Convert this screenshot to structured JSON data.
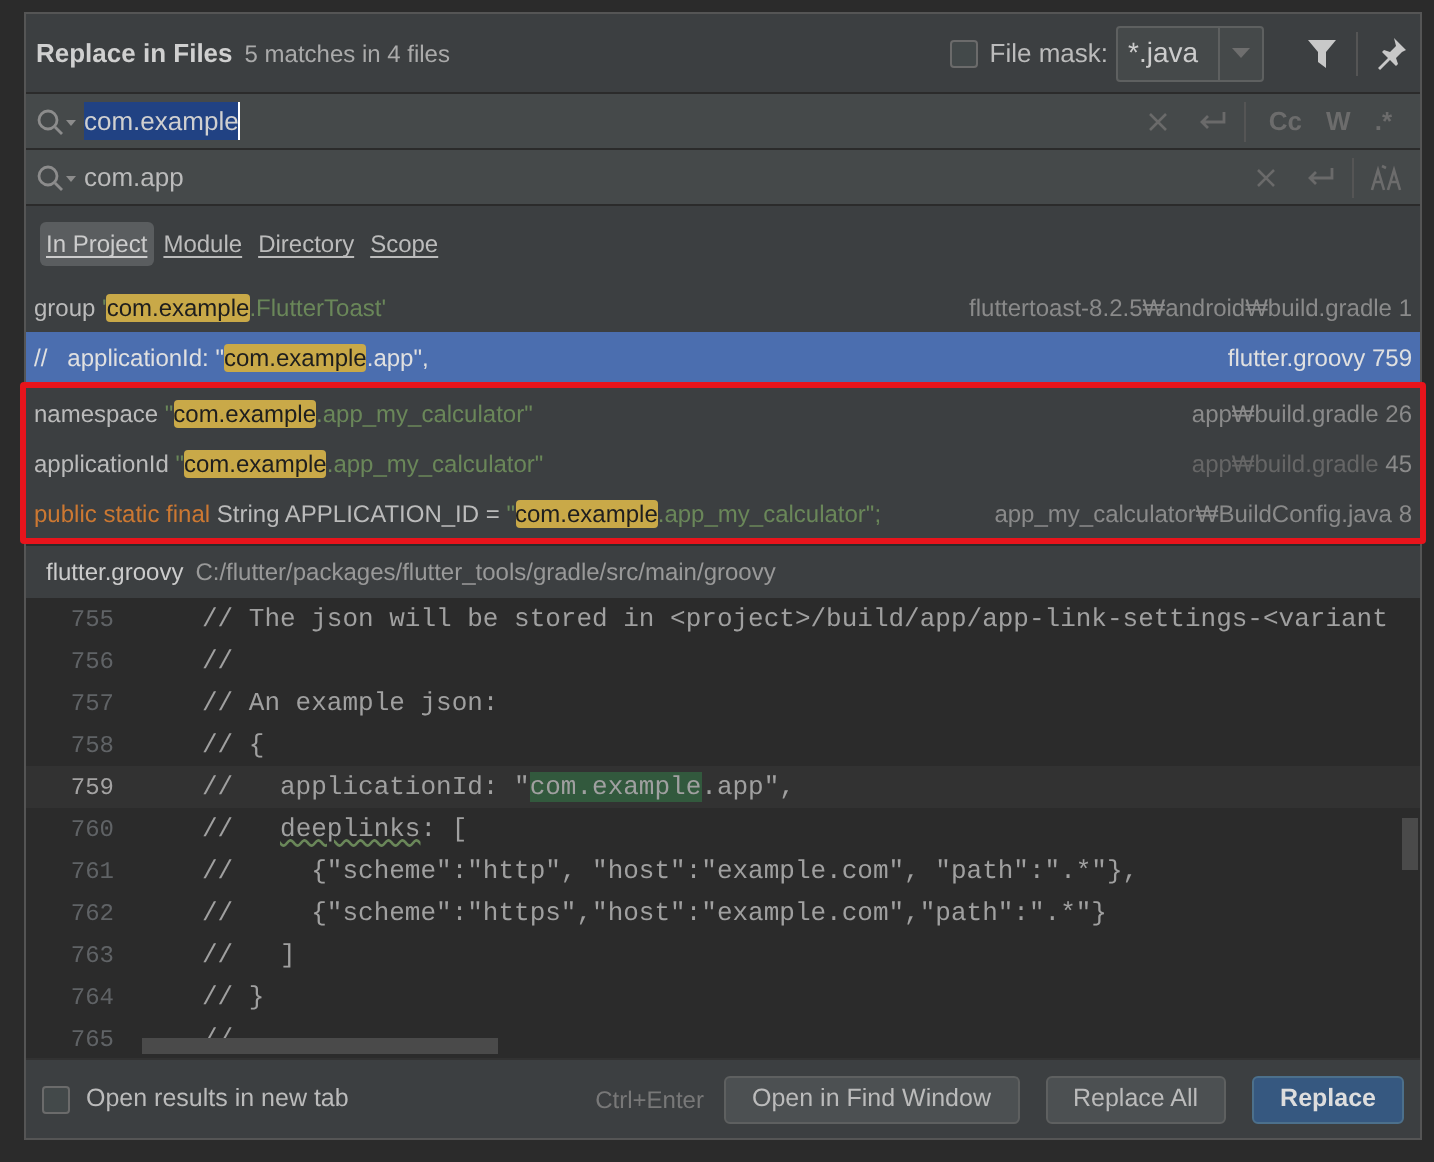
{
  "dialog": {
    "title": "Replace in Files",
    "summary": "5 matches in 4 files",
    "file_mask": {
      "label": "File mask:",
      "checked": false,
      "value": "*.java"
    },
    "find": {
      "value": "com.example",
      "options": [
        {
          "label": "Cc",
          "selected": false
        },
        {
          "label": "W",
          "selected": false
        },
        {
          "label": ".*",
          "selected": false
        }
      ]
    },
    "replace": {
      "value": "com.app"
    },
    "scopes": [
      {
        "label": "In Project",
        "selected": true
      },
      {
        "label": "Module",
        "selected": false
      },
      {
        "label": "Directory",
        "selected": false
      },
      {
        "label": "Scope",
        "selected": false
      }
    ],
    "results": [
      {
        "selected": false,
        "boxed": false,
        "dimmed": false,
        "parts": [
          {
            "kind": "plain",
            "text": "group "
          },
          {
            "kind": "string",
            "text": "'"
          },
          {
            "kind": "match",
            "text": "com.example"
          },
          {
            "kind": "string",
            "text": ".FlutterToast'"
          }
        ],
        "file": "fluttertoast-8.2.5₩android₩build.gradle",
        "line": "1"
      },
      {
        "selected": true,
        "boxed": false,
        "dimmed": false,
        "parts": [
          {
            "kind": "plain",
            "text": "//   applicationId: \""
          },
          {
            "kind": "match",
            "text": "com.example"
          },
          {
            "kind": "plain",
            "text": ".app\","
          }
        ],
        "file": "flutter.groovy",
        "line": "759"
      },
      {
        "selected": false,
        "boxed": true,
        "dimmed": false,
        "parts": [
          {
            "kind": "plain",
            "text": "namespace "
          },
          {
            "kind": "string",
            "text": "\""
          },
          {
            "kind": "match",
            "text": "com.example"
          },
          {
            "kind": "string",
            "text": ".app_my_calculator\""
          }
        ],
        "file": "app₩build.gradle",
        "line": "26"
      },
      {
        "selected": false,
        "boxed": true,
        "dimmed": true,
        "parts": [
          {
            "kind": "plain",
            "text": "applicationId "
          },
          {
            "kind": "string",
            "text": "\""
          },
          {
            "kind": "match",
            "text": "com.example"
          },
          {
            "kind": "string",
            "text": ".app_my_calculator\""
          }
        ],
        "file": "app₩build.gradle",
        "line": "45"
      },
      {
        "selected": false,
        "boxed": true,
        "dimmed": false,
        "parts": [
          {
            "kind": "keyword",
            "text": "public static final "
          },
          {
            "kind": "plain",
            "text": "String APPLICATION_ID = "
          },
          {
            "kind": "string",
            "text": "\""
          },
          {
            "kind": "match",
            "text": "com.example"
          },
          {
            "kind": "string",
            "text": ".app_my_calculator\";"
          }
        ],
        "file": "app_my_calculator₩BuildConfig.java",
        "line": "8"
      }
    ],
    "preview": {
      "file": "flutter.groovy",
      "path": "C:/flutter/packages/flutter_tools/gradle/src/main/groovy",
      "lines": [
        {
          "number": "755",
          "current": false,
          "parts": [
            {
              "kind": "comment",
              "text": "// The json will be stored in <project>/build/app/app-link-settings-<variant"
            }
          ]
        },
        {
          "number": "756",
          "current": false,
          "parts": [
            {
              "kind": "comment",
              "text": "//"
            }
          ]
        },
        {
          "number": "757",
          "current": false,
          "parts": [
            {
              "kind": "comment",
              "text": "// An example json:"
            }
          ]
        },
        {
          "number": "758",
          "current": false,
          "parts": [
            {
              "kind": "comment",
              "text": "// {"
            }
          ]
        },
        {
          "number": "759",
          "current": true,
          "parts": [
            {
              "kind": "comment",
              "text": "//   applicationId: \""
            },
            {
              "kind": "match",
              "text": "com.example"
            },
            {
              "kind": "comment",
              "text": ".app\","
            }
          ]
        },
        {
          "number": "760",
          "current": false,
          "parts": [
            {
              "kind": "comment",
              "text": "//   "
            },
            {
              "kind": "typo",
              "text": "deeplinks"
            },
            {
              "kind": "comment",
              "text": ": ["
            }
          ]
        },
        {
          "number": "761",
          "current": false,
          "parts": [
            {
              "kind": "comment",
              "text": "//     {\"scheme\":\"http\", \"host\":\"example.com\", \"path\":\".*\"},"
            }
          ]
        },
        {
          "number": "762",
          "current": false,
          "parts": [
            {
              "kind": "comment",
              "text": "//     {\"scheme\":\"https\",\"host\":\"example.com\",\"path\":\".*\"}"
            }
          ]
        },
        {
          "number": "763",
          "current": false,
          "parts": [
            {
              "kind": "comment",
              "text": "//   ]"
            }
          ]
        },
        {
          "number": "764",
          "current": false,
          "parts": [
            {
              "kind": "comment",
              "text": "// }"
            }
          ]
        },
        {
          "number": "765",
          "current": false,
          "parts": [
            {
              "kind": "comment",
              "text": "//"
            }
          ]
        }
      ]
    },
    "footer": {
      "new_tab": {
        "label": "Open results in new tab",
        "checked": false
      },
      "shortcut": "Ctrl+Enter",
      "buttons": [
        {
          "label": "Open in Find Window",
          "kind": "normal"
        },
        {
          "label": "Replace All",
          "kind": "normal"
        },
        {
          "label": "Replace",
          "kind": "default"
        }
      ]
    }
  }
}
